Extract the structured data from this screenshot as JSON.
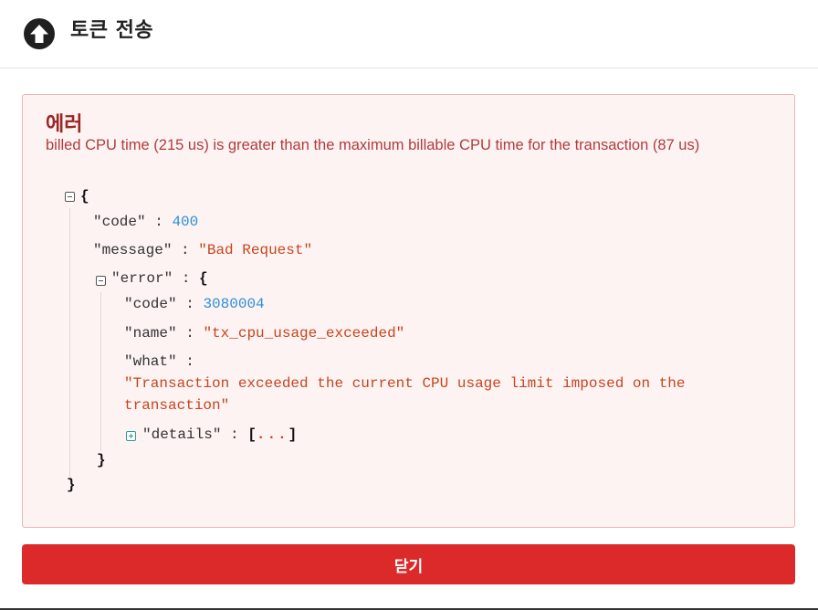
{
  "header": {
    "icon": "arrow-up-circle-icon",
    "title": "토큰 전송"
  },
  "error": {
    "title": "에러",
    "message": "billed CPU time (215 us) is greater than the maximum billable CPU time for the transaction (87 us)",
    "json": {
      "open_brace": "{",
      "close_brace": "}",
      "code_key": "\"code\"",
      "code_value": "400",
      "message_key": "\"message\"",
      "message_value": "\"Bad Request\"",
      "error_key": "\"error\"",
      "error_open": "{",
      "error_close": "}",
      "error_code_key": "\"code\"",
      "error_code_value": "3080004",
      "name_key": "\"name\"",
      "name_value": "\"tx_cpu_usage_exceeded\"",
      "what_key": "\"what\"",
      "what_value_line1": "\"Transaction exceeded the current CPU usage limit imposed on the",
      "what_value_line2": "transaction\"",
      "details_key": "\"details\"",
      "details_open": "[",
      "details_ellipsis": "...",
      "details_close": "]",
      "colon": ":"
    }
  },
  "close_button": {
    "label": "닫기"
  },
  "colors": {
    "accent": "#dc2a2a",
    "error_text": "#9c2525",
    "error_bg": "#fdf3f3",
    "number": "#2b8fd6",
    "string": "#c4461e"
  }
}
